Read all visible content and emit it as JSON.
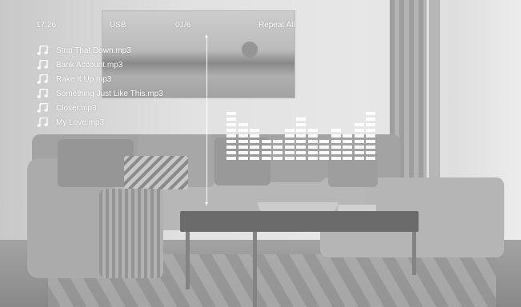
{
  "status": {
    "time": "17:26",
    "source": "USB",
    "track_position": "01/6",
    "repeat_mode": "Repeat All"
  },
  "playlist": {
    "items": [
      {
        "label": "Strip That Down.mp3",
        "icon": "music-note-icon"
      },
      {
        "label": "Bank Account.mp3",
        "icon": "music-note-icon"
      },
      {
        "label": "Rake It Up.mp3",
        "icon": "music-note-icon"
      },
      {
        "label": "Something Just Like This.mp3",
        "icon": "music-note-icon"
      },
      {
        "label": "Closer.mp3",
        "icon": "music-note-icon"
      },
      {
        "label": "My Love.mp3",
        "icon": "music-note-icon"
      }
    ]
  },
  "progress": {
    "orientation": "vertical",
    "icons": [
      "arrow-up-icon",
      "arrow-down-icon"
    ]
  },
  "equalizer": {
    "bar_levels": [
      9,
      7,
      6,
      4,
      4,
      6,
      8,
      6,
      4,
      6,
      5,
      7,
      9
    ]
  },
  "colors": {
    "osd_text": "#ffffff"
  }
}
